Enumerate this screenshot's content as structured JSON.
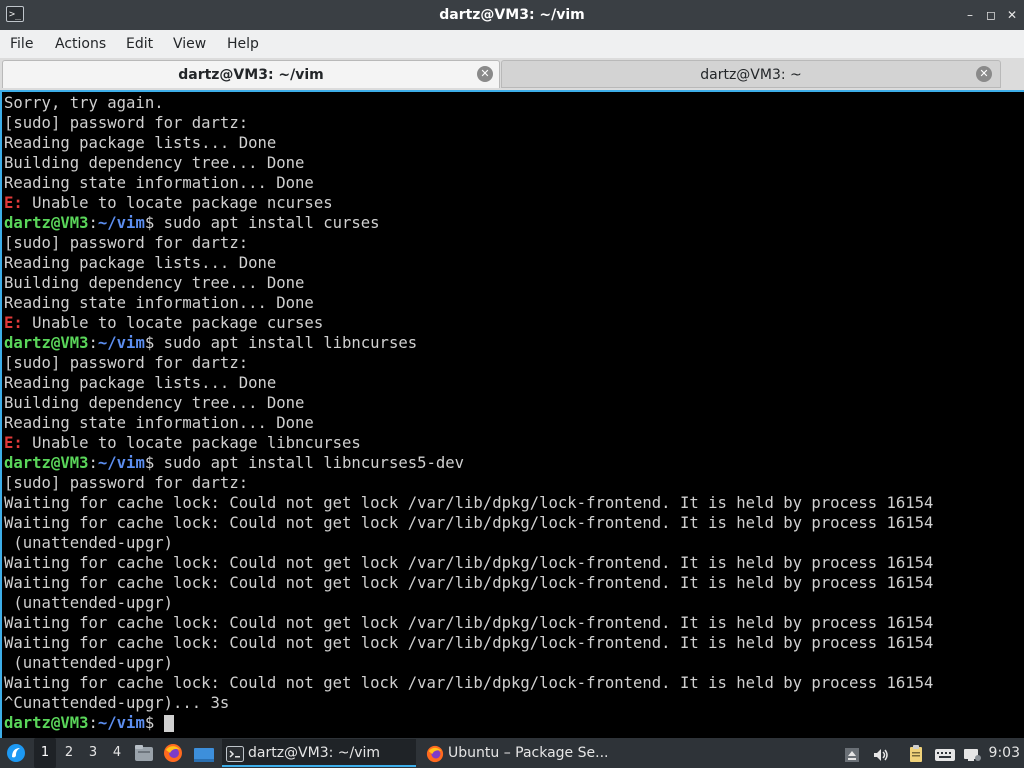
{
  "window": {
    "title": "dartz@VM3: ~/vim",
    "app_icon_glyph": ">_",
    "minimize_glyph": "–",
    "maximize_glyph": "◻",
    "close_glyph": "✕"
  },
  "menu": [
    "File",
    "Actions",
    "Edit",
    "View",
    "Help"
  ],
  "tabs": [
    {
      "label": "dartz@VM3: ~/vim",
      "active": true
    },
    {
      "label": "dartz@VM3: ~",
      "active": false
    }
  ],
  "terminal": {
    "prompt_user": "dartz@VM3",
    "prompt_path": "~/vim",
    "lines": [
      {
        "type": "text",
        "text": "Sorry, try again."
      },
      {
        "type": "text",
        "text": "[sudo] password for dartz:"
      },
      {
        "type": "text",
        "text": "Reading package lists... Done"
      },
      {
        "type": "text",
        "text": "Building dependency tree... Done"
      },
      {
        "type": "text",
        "text": "Reading state information... Done"
      },
      {
        "type": "error",
        "tag": "E:",
        "text": " Unable to locate package ncurses"
      },
      {
        "type": "prompt",
        "text": " sudo apt install curses"
      },
      {
        "type": "text",
        "text": "[sudo] password for dartz:"
      },
      {
        "type": "text",
        "text": "Reading package lists... Done"
      },
      {
        "type": "text",
        "text": "Building dependency tree... Done"
      },
      {
        "type": "text",
        "text": "Reading state information... Done"
      },
      {
        "type": "error",
        "tag": "E:",
        "text": " Unable to locate package curses"
      },
      {
        "type": "prompt",
        "text": " sudo apt install libncurses"
      },
      {
        "type": "text",
        "text": "[sudo] password for dartz:"
      },
      {
        "type": "text",
        "text": "Reading package lists... Done"
      },
      {
        "type": "text",
        "text": "Building dependency tree... Done"
      },
      {
        "type": "text",
        "text": "Reading state information... Done"
      },
      {
        "type": "error",
        "tag": "E:",
        "text": " Unable to locate package libncurses"
      },
      {
        "type": "prompt",
        "text": " sudo apt install libncurses5-dev"
      },
      {
        "type": "text",
        "text": "[sudo] password for dartz:"
      },
      {
        "type": "text",
        "text": "Waiting for cache lock: Could not get lock /var/lib/dpkg/lock-frontend. It is held by process 16154"
      },
      {
        "type": "text",
        "text": "Waiting for cache lock: Could not get lock /var/lib/dpkg/lock-frontend. It is held by process 16154"
      },
      {
        "type": "text",
        "text": " (unattended-upgr)"
      },
      {
        "type": "text",
        "text": "Waiting for cache lock: Could not get lock /var/lib/dpkg/lock-frontend. It is held by process 16154"
      },
      {
        "type": "text",
        "text": "Waiting for cache lock: Could not get lock /var/lib/dpkg/lock-frontend. It is held by process 16154"
      },
      {
        "type": "text",
        "text": " (unattended-upgr)"
      },
      {
        "type": "text",
        "text": "Waiting for cache lock: Could not get lock /var/lib/dpkg/lock-frontend. It is held by process 16154"
      },
      {
        "type": "text",
        "text": "Waiting for cache lock: Could not get lock /var/lib/dpkg/lock-frontend. It is held by process 16154"
      },
      {
        "type": "text",
        "text": " (unattended-upgr)"
      },
      {
        "type": "text",
        "text": "Waiting for cache lock: Could not get lock /var/lib/dpkg/lock-frontend. It is held by process 16154"
      },
      {
        "type": "text",
        "text": "^Cunattended-upgr)... 3s"
      },
      {
        "type": "prompt_cursor",
        "text": " "
      }
    ]
  },
  "taskbar": {
    "workspaces": [
      "1",
      "2",
      "3",
      "4"
    ],
    "current_workspace": "1",
    "launcher_icons": [
      "start-menu-icon",
      "file-manager-icon",
      "firefox-icon",
      "desktop-icon"
    ],
    "tasks": [
      {
        "label": "dartz@VM3: ~/vim",
        "icon": "terminal-icon",
        "active": true
      },
      {
        "label": "Ubuntu – Package Se...",
        "icon": "firefox-icon",
        "active": false
      }
    ],
    "tray_icons": [
      "eject-icon",
      "volume-icon",
      "clipboard-icon",
      "keyboard-icon",
      "network-icon"
    ],
    "clock": "9:03"
  },
  "colors": {
    "accent": "#3daee9",
    "prompt_user": "#5ad65a",
    "prompt_path": "#5c8ef0",
    "error_tag": "#e03a3a",
    "terminal_bg": "#000000",
    "terminal_fg": "#d0d0d0"
  }
}
